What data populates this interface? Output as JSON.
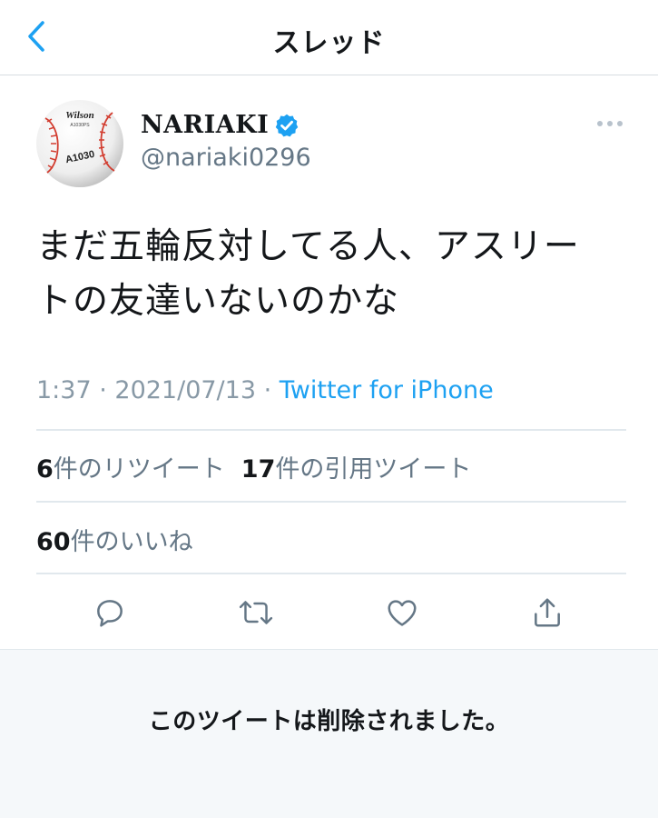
{
  "header": {
    "title": "スレッド",
    "back_icon": "chevron-left-icon"
  },
  "tweet": {
    "display_name": "NARIAKI",
    "verified": true,
    "handle": "@nariaki0296",
    "text_line1": "まだ五輪反対してる人、アスリー",
    "text_line2": "トの友達いないのかな",
    "time": "1:37",
    "sep1": " · ",
    "date": "2021/07/13",
    "sep2": " · ",
    "source": "Twitter for iPhone",
    "avatar": {
      "ball_text_brand": "Wilson",
      "ball_text_sub": "A1030PS",
      "ball_text_model": "A1030"
    }
  },
  "stats": {
    "retweets_count": "6",
    "retweets_label": "件のリツイート",
    "quotes_count": "17",
    "quotes_label": "件の引用ツイート",
    "likes_count": "60",
    "likes_label": "件のいいね"
  },
  "actions": [
    "reply-icon",
    "retweet-icon",
    "like-icon",
    "share-icon"
  ],
  "colors": {
    "accent": "#1da1f2",
    "secondary_text": "#657786",
    "meta_text": "#8899a6",
    "deleted_bg": "#f5f8fa"
  },
  "deleted_notice": "このツイートは削除されました。"
}
